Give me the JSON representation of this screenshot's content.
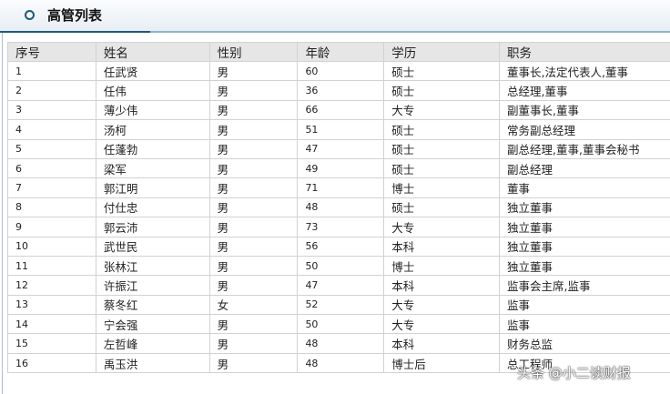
{
  "title": "高管列表",
  "columns": [
    "序号",
    "姓名",
    "性别",
    "年龄",
    "学历",
    "职务"
  ],
  "rows": [
    [
      "1",
      "任武贤",
      "男",
      "60",
      "硕士",
      "董事长,法定代表人,董事"
    ],
    [
      "2",
      "任伟",
      "男",
      "36",
      "硕士",
      "总经理,董事"
    ],
    [
      "3",
      "薄少伟",
      "男",
      "66",
      "大专",
      "副董事长,董事"
    ],
    [
      "4",
      "汤柯",
      "男",
      "51",
      "硕士",
      "常务副总经理"
    ],
    [
      "5",
      "任蓬勃",
      "男",
      "47",
      "硕士",
      "副总经理,董事,董事会秘书"
    ],
    [
      "6",
      "梁军",
      "男",
      "49",
      "硕士",
      "副总经理"
    ],
    [
      "7",
      "郭江明",
      "男",
      "71",
      "博士",
      "董事"
    ],
    [
      "8",
      "付仕忠",
      "男",
      "48",
      "硕士",
      "独立董事"
    ],
    [
      "9",
      "郭云沛",
      "男",
      "73",
      "大专",
      "独立董事"
    ],
    [
      "10",
      "武世民",
      "男",
      "56",
      "本科",
      "独立董事"
    ],
    [
      "11",
      "张林江",
      "男",
      "50",
      "博士",
      "独立董事"
    ],
    [
      "12",
      "许振江",
      "男",
      "47",
      "本科",
      "监事会主席,监事"
    ],
    [
      "13",
      "蔡冬红",
      "女",
      "52",
      "大专",
      "监事"
    ],
    [
      "14",
      "宁会强",
      "男",
      "50",
      "大专",
      "监事"
    ],
    [
      "15",
      "左哲峰",
      "男",
      "48",
      "本科",
      "财务总监"
    ],
    [
      "16",
      "禹玉洪",
      "男",
      "48",
      "博士后",
      "总工程师"
    ]
  ],
  "watermark": "头条 @小二读财报"
}
